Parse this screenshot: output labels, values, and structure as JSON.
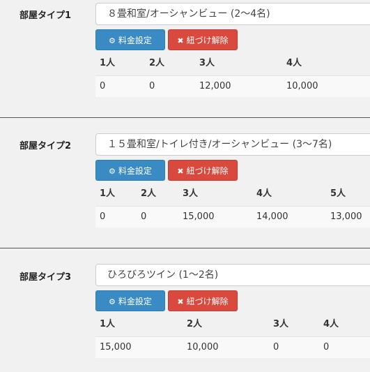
{
  "buttons": {
    "fee_label": "料金設定",
    "unlink_label": "紐づけ解除"
  },
  "room_types": [
    {
      "label": "部屋タイプ1",
      "name": "８畳和室/オーシャンビュー (2〜4名)",
      "headers": [
        "1人",
        "2人",
        "3人",
        "4人"
      ],
      "values": [
        "0",
        "0",
        "12,000",
        "10,000"
      ]
    },
    {
      "label": "部屋タイプ2",
      "name": "１５畳和室/トイレ付き/オーシャンビュー (3〜7名)",
      "headers": [
        "1人",
        "2人",
        "3人",
        "4人",
        "5人"
      ],
      "values": [
        "0",
        "0",
        "15,000",
        "14,000",
        "13,000"
      ]
    },
    {
      "label": "部屋タイプ3",
      "name": "ひろびろツイン (1〜2名)",
      "headers": [
        "1人",
        "2人",
        "3人",
        "4人"
      ],
      "values": [
        "15,000",
        "10,000",
        "0",
        "0"
      ]
    }
  ],
  "colors": {
    "fee_button": "#3a8bc4",
    "unlink_button": "#d9493e",
    "background": "#f1f1f1"
  },
  "icons": {
    "fee": "gears-icon",
    "unlink": "times-icon"
  }
}
